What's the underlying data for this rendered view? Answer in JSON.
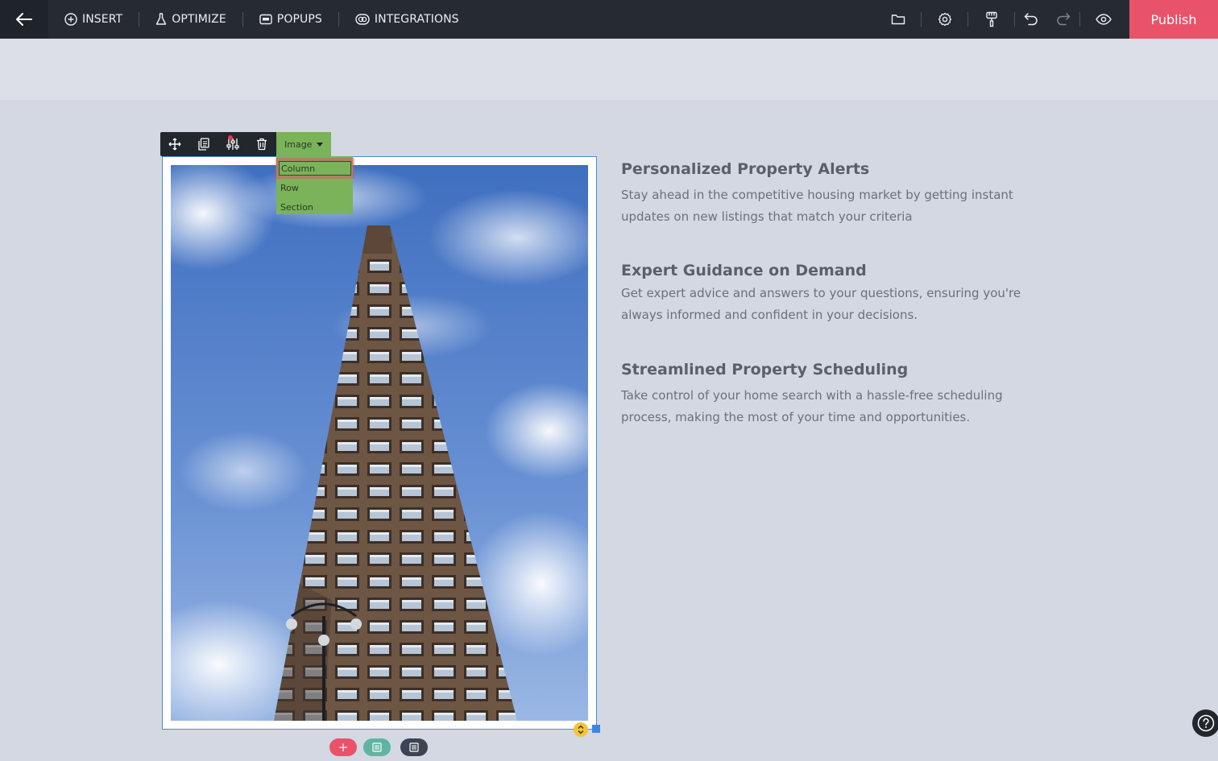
{
  "topbar": {
    "nav": [
      {
        "label": "INSERT",
        "icon": "plus-circle-icon"
      },
      {
        "label": "OPTIMIZE",
        "icon": "flask-icon"
      },
      {
        "label": "POPUPS",
        "icon": "popup-window-icon"
      },
      {
        "label": "INTEGRATIONS",
        "icon": "integrations-icon"
      }
    ],
    "tools": [
      "folder-icon",
      "settings-icon",
      "paint-roller-icon",
      "undo-icon",
      "redo-icon",
      "eye-preview-icon"
    ],
    "publish_label": "Publish"
  },
  "element_toolbar": {
    "type_label": "Image",
    "tools": [
      "move-icon",
      "duplicate-icon",
      "sliders-icon",
      "trash-icon"
    ]
  },
  "dropdown": {
    "items": [
      "Column",
      "Row",
      "Section"
    ],
    "selected": "Column"
  },
  "features": [
    {
      "title": "Personalized Property Alerts",
      "body": "Stay ahead in the competitive housing market by getting instant updates on new listings that match your criteria"
    },
    {
      "title": "Expert Guidance on Demand",
      "body": "Get expert advice and answers to your questions, ensuring you're always informed and confident in your decisions."
    },
    {
      "title": "Streamlined Property Scheduling",
      "body": "Take control of your home search with a hassle-free scheduling process, making the most of your time and opportunities."
    }
  ],
  "colors": {
    "accent_publish": "#e8536a",
    "element_type": "#7ab35a",
    "selection_border": "#4a8bd6"
  }
}
